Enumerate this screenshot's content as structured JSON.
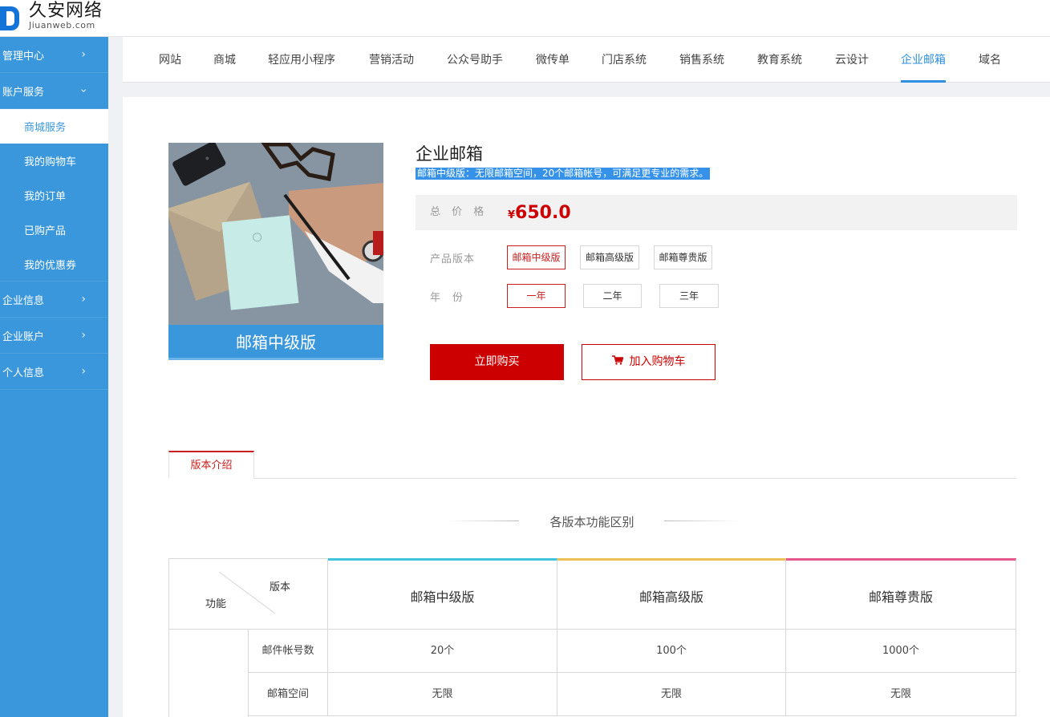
{
  "brand": {
    "name_cn": "久安网络",
    "name_en": "Jiuanweb.com"
  },
  "sidebar": {
    "items": [
      {
        "label": "管理中心",
        "chevron": ">"
      },
      {
        "label": "账户服务",
        "chevron": "v"
      }
    ],
    "sub_items": [
      {
        "label": "商城服务"
      },
      {
        "label": "我的购物车"
      },
      {
        "label": "我的订单"
      },
      {
        "label": "已购产品"
      },
      {
        "label": "我的优惠券"
      }
    ],
    "items_after": [
      {
        "label": "企业信息",
        "chevron": ">"
      },
      {
        "label": "企业账户",
        "chevron": ">"
      },
      {
        "label": "个人信息",
        "chevron": ">"
      }
    ]
  },
  "nav": {
    "tabs": [
      "网站",
      "商城",
      "轻应用小程序",
      "营销活动",
      "公众号助手",
      "微传单",
      "门店系统",
      "销售系统",
      "教育系统",
      "云设计",
      "企业邮箱",
      "域名"
    ],
    "active": "企业邮箱"
  },
  "product": {
    "image_caption": "邮箱中级版",
    "title": "企业邮箱",
    "description": "邮箱中级版：无限邮箱空间，20个邮箱帐号，可满足更专业的需求。",
    "price_label": "总 价 格",
    "currency": "¥",
    "price": "650.0",
    "version_label": "产品版本",
    "versions": [
      "邮箱中级版",
      "邮箱高级版",
      "邮箱尊贵版"
    ],
    "selected_version": "邮箱中级版",
    "year_label": "年　份",
    "years": [
      "一年",
      "二年",
      "三年"
    ],
    "selected_year": "一年",
    "buy_label": "立即购买",
    "cart_label": "加入购物车",
    "cart_icon": "shopping-cart-icon"
  },
  "section_tab": "版本介绍",
  "comparison": {
    "title": "各版本功能区别",
    "corner_top": "版本",
    "corner_bottom": "功能",
    "columns": [
      {
        "name": "邮箱中级版",
        "color": "#3fc4dc"
      },
      {
        "name": "邮箱高级版",
        "color": "#ecc054"
      },
      {
        "name": "邮箱尊贵版",
        "color": "#e5588b"
      }
    ],
    "rows": [
      {
        "feature": "邮件帐号数",
        "values": [
          "20个",
          "100个",
          "1000个"
        ]
      },
      {
        "feature": "邮箱空间",
        "values": [
          "无限",
          "无限",
          "无限"
        ]
      }
    ]
  },
  "colors": {
    "sidebar": "#3a97dc",
    "accent": "#2f8fe0",
    "price": "#cc0000"
  }
}
